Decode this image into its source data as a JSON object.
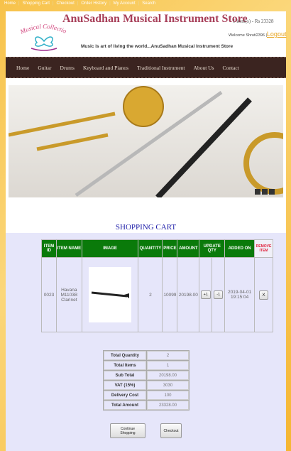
{
  "top_links": [
    "Home",
    "Shopping Cart",
    "Checkout",
    "Order History",
    "My Account",
    "Search"
  ],
  "header": {
    "title": "AnuSadhan Musical Instrument Store",
    "cart_info": "1 item(s) - Rs 23328",
    "welcome": "Welcome Shruti2396 |",
    "logout": "Logout",
    "tagline": "Music is art of living the world...AnuSadhan Musical Instrument Store",
    "logo_text": "Musical Collection"
  },
  "nav": [
    "Home",
    "Guitar",
    "Drums",
    "Keyboard and Pianos",
    "Traditional Instrument",
    "About Us",
    "Contact"
  ],
  "cart": {
    "heading": "SHOPPING CART",
    "columns": [
      "ITEM ID",
      "ITEM NAME",
      "IMAGE",
      "QUANTITY",
      "PRICE",
      "AMOUNT",
      "UPDATE QTY",
      "ADDED ON",
      "REMOVE ITEM"
    ],
    "rows": [
      {
        "id": "0023",
        "name": "Havana M1103B Clarinet",
        "quantity": "2",
        "price": "10099",
        "amount": "20198.00",
        "inc": "+1",
        "dec": "-1",
        "added_on": "2019-04-01 19:15:04",
        "remove": "X"
      }
    ]
  },
  "summary": [
    {
      "label": "Total Quantity",
      "value": "2"
    },
    {
      "label": "Total Items",
      "value": "1"
    },
    {
      "label": "Sub Total",
      "value": "20198.00"
    },
    {
      "label": "VAT (15%)",
      "value": "3030"
    },
    {
      "label": "Delivery Cost",
      "value": "100"
    },
    {
      "label": "Total Amount",
      "value": "23328.00"
    }
  ],
  "buttons": {
    "continue": "Continue Shopping",
    "checkout": "Checkout"
  }
}
